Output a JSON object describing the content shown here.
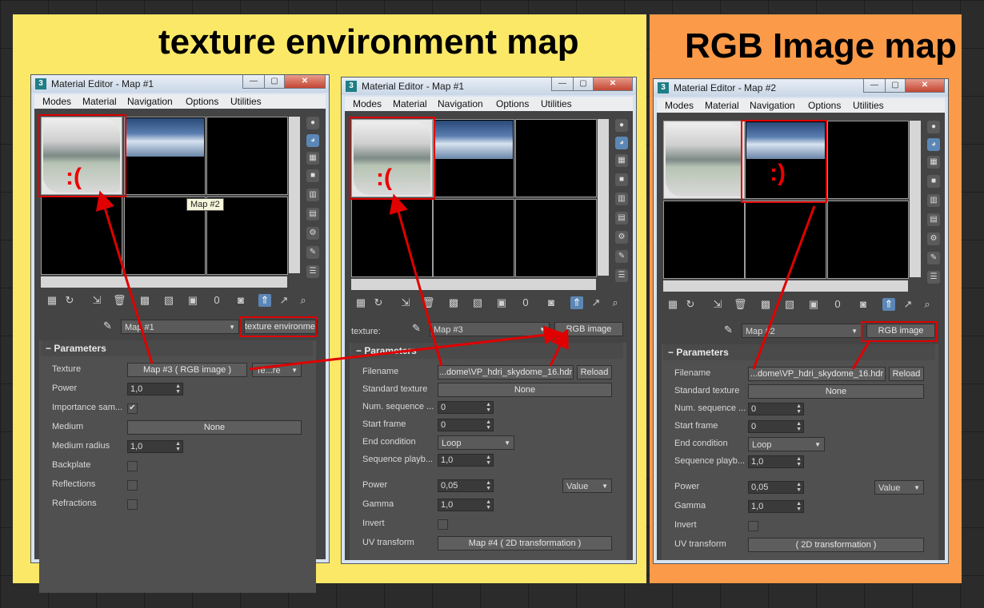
{
  "banners": {
    "left": "texture environment map",
    "right": "RGB Image map"
  },
  "colors": {
    "left_banner": "#fbe867",
    "right_banner": "#fb9a48",
    "annotation": "#e00000"
  },
  "win1": {
    "title": "Material Editor - Map #1",
    "menu": [
      "Modes",
      "Material",
      "Navigation",
      "Options",
      "Utilities"
    ],
    "tooltip": "Map #2",
    "map_dropdown": "Map #1",
    "type_button": "texture environmen",
    "rollout": "Parameters",
    "rows": [
      {
        "label": "Texture",
        "value": "Map #3  ( RGB image )",
        "extra": "Te...re"
      },
      {
        "label": "Power",
        "value": "1,0"
      },
      {
        "label": "Importance sam...",
        "check": "✔"
      },
      {
        "label": "Medium",
        "value": "None"
      },
      {
        "label": "Medium radius",
        "value": "1,0"
      },
      {
        "label": "Backplate"
      },
      {
        "label": "Reflections"
      },
      {
        "label": "Refractions"
      }
    ]
  },
  "win2": {
    "title": "Material Editor - Map #1",
    "menu": [
      "Modes",
      "Material",
      "Navigation",
      "Options",
      "Utilities"
    ],
    "slot_label": "texture:",
    "map_dropdown": "Map #3",
    "type_button": "RGB image",
    "rollout": "Parameters",
    "filename": "...dome\\VP_hdri_skydome_16.hdr",
    "reload": "Reload",
    "rows": [
      {
        "label": "Filename"
      },
      {
        "label": "Standard texture",
        "value": "None"
      },
      {
        "label": "Num. sequence ...",
        "value": "0"
      },
      {
        "label": "Start frame",
        "value": "0"
      },
      {
        "label": "End condition",
        "value": "Loop"
      },
      {
        "label": "Sequence playb...",
        "value": "1,0"
      },
      {
        "label": "Power",
        "value": "0,05",
        "extra": "Value"
      },
      {
        "label": "Gamma",
        "value": "1,0"
      },
      {
        "label": "Invert"
      },
      {
        "label": "UV transform",
        "value": "Map #4  ( 2D transformation )"
      }
    ]
  },
  "win3": {
    "title": "Material Editor - Map #2",
    "menu": [
      "Modes",
      "Material",
      "Navigation",
      "Options",
      "Utilities"
    ],
    "map_dropdown": "Map #2",
    "type_button": "RGB image",
    "rollout": "Parameters",
    "filename": "...dome\\VP_hdri_skydome_16.hdr",
    "reload": "Reload",
    "rows": [
      {
        "label": "Filename"
      },
      {
        "label": "Standard texture",
        "value": "None"
      },
      {
        "label": "Num. sequence ...",
        "value": "0"
      },
      {
        "label": "Start frame",
        "value": "0"
      },
      {
        "label": "End condition",
        "value": "Loop"
      },
      {
        "label": "Sequence playb...",
        "value": "1,0"
      },
      {
        "label": "Power",
        "value": "0,05",
        "extra": "Value"
      },
      {
        "label": "Gamma",
        "value": "1,0"
      },
      {
        "label": "Invert"
      },
      {
        "label": "UV transform",
        "value": "( 2D transformation )"
      }
    ]
  }
}
